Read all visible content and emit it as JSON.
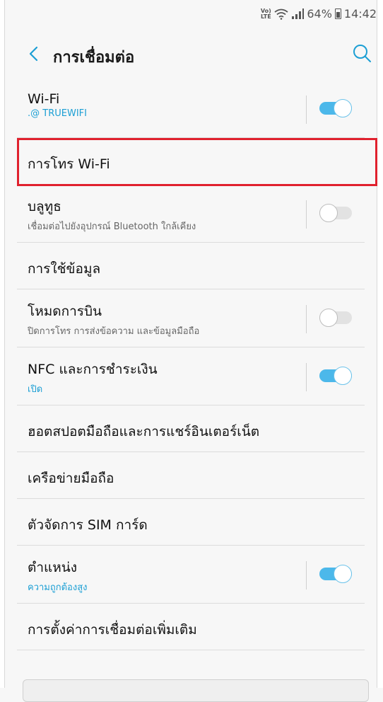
{
  "status_bar": {
    "volte": "Vo) LTE",
    "battery_percent": "64%",
    "time": "14:42"
  },
  "app_bar": {
    "title": "การเชื่อมต่อ",
    "back_icon": "chevron-left-icon",
    "search_icon": "search-icon"
  },
  "settings": [
    {
      "title": "Wi-Fi",
      "subtitle": ".@ TRUEWIFI",
      "subtitle_style": "blue",
      "toggle": true
    },
    {
      "title": "การโทร Wi-Fi",
      "highlighted": true
    },
    {
      "title": "บลูทูธ",
      "subtitle": "เชื่อมต่อไปยังอุปกรณ์ Bluetooth ใกล้เคียง",
      "subtitle_style": "gray",
      "toggle": false
    },
    {
      "title": "การใช้ข้อมูล"
    },
    {
      "title": "โหมดการบิน",
      "subtitle": "ปิดการโทร การส่งข้อความ และข้อมูลมือถือ",
      "subtitle_style": "gray",
      "toggle": false
    },
    {
      "title": "NFC และการชำระเงิน",
      "subtitle": "เปิด",
      "subtitle_style": "blue",
      "toggle": true
    },
    {
      "title": "ฮอตสปอตมือถือและการแชร์อินเตอร์เน็ต"
    },
    {
      "title": "เครือข่ายมือถือ"
    },
    {
      "title": "ตัวจัดการ SIM การ์ด"
    },
    {
      "title": "ตำแหน่ง",
      "subtitle": "ความถูกต้องสูง",
      "subtitle_style": "blue",
      "toggle": true
    },
    {
      "title": "การตั้งค่าการเชื่อมต่อเพิ่มเติม"
    }
  ],
  "colors": {
    "accent": "#4cb8ea",
    "highlight_border": "#e0212e",
    "subtitle_blue": "#1c9fd4"
  }
}
